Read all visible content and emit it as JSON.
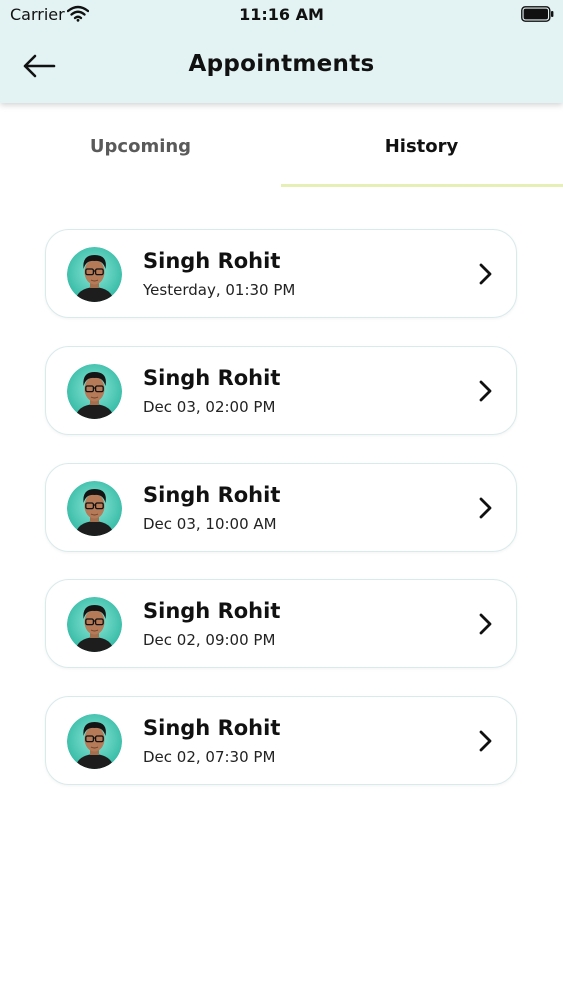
{
  "status_bar": {
    "carrier": "Carrier",
    "time": "11:16 AM",
    "icons": [
      "wifi-icon",
      "battery-icon"
    ]
  },
  "header": {
    "title": "Appointments",
    "back_icon": "arrow-left-icon",
    "background_color": "#e3f2f2"
  },
  "tabs": [
    {
      "label": "Upcoming",
      "active": false
    },
    {
      "label": "History",
      "active": true
    }
  ],
  "tab_indicator_color": "#e6efb5",
  "appointments": [
    {
      "name": "Singh Rohit",
      "datetime": "Yesterday, 01:30 PM"
    },
    {
      "name": "Singh Rohit",
      "datetime": "Dec 03, 02:00 PM"
    },
    {
      "name": "Singh Rohit",
      "datetime": "Dec 03, 10:00 AM"
    },
    {
      "name": "Singh Rohit",
      "datetime": "Dec 02, 09:00 PM"
    },
    {
      "name": "Singh Rohit",
      "datetime": "Dec 02, 07:30 PM"
    }
  ]
}
